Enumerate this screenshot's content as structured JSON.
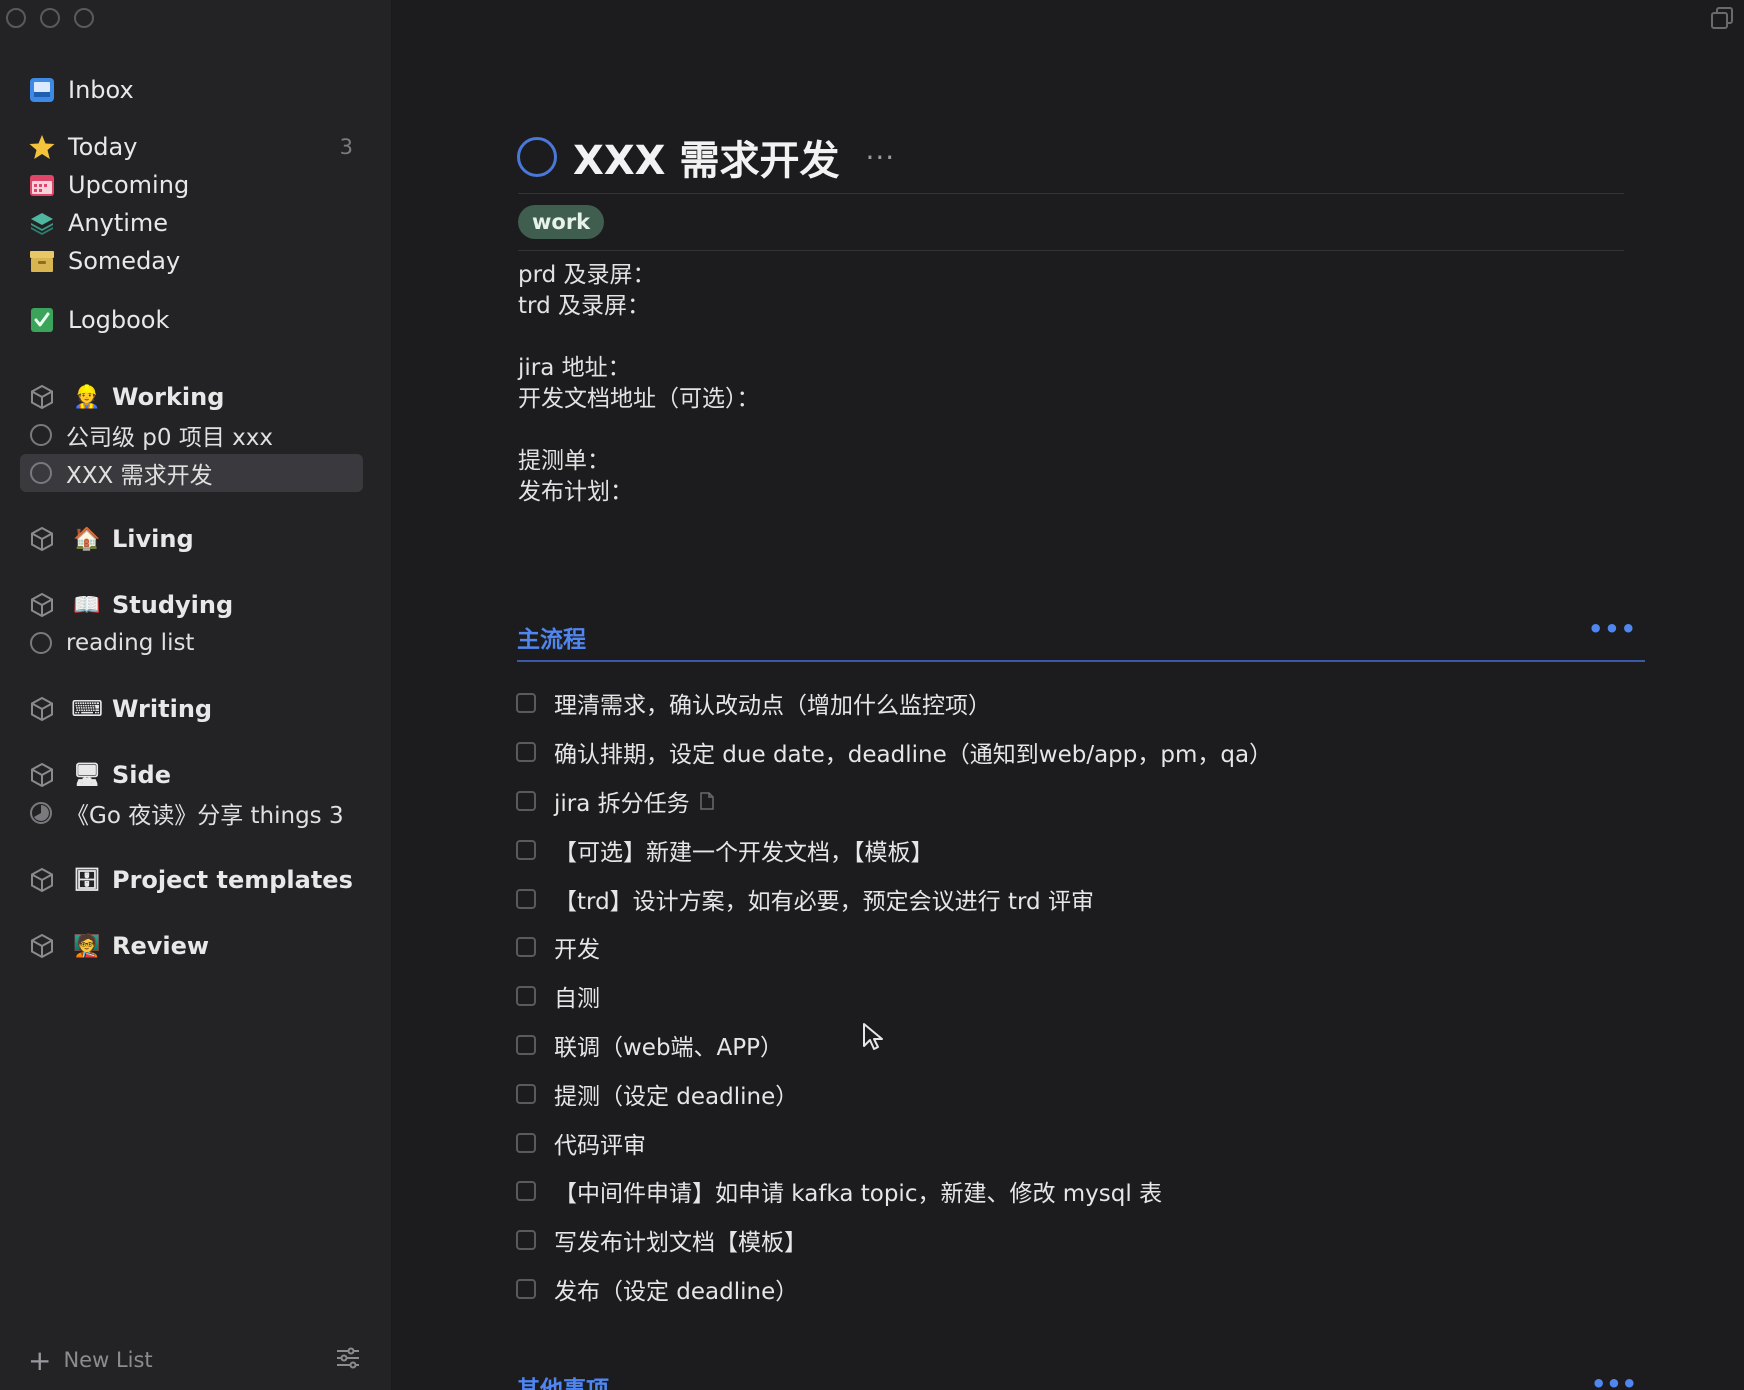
{
  "sidebar": {
    "nav": [
      {
        "label": "Inbox",
        "icon": "inbox-icon",
        "count": ""
      },
      {
        "label": "Today",
        "icon": "star-icon",
        "count": "3"
      },
      {
        "label": "Upcoming",
        "icon": "calendar-icon",
        "count": ""
      },
      {
        "label": "Anytime",
        "icon": "layers-icon",
        "count": ""
      },
      {
        "label": "Someday",
        "icon": "archive-box-icon",
        "count": ""
      },
      {
        "label": "Logbook",
        "icon": "logbook-check-icon",
        "count": ""
      }
    ],
    "areas": [
      {
        "label": "Working",
        "emoji": "👷",
        "projects": [
          "公司级 p0 项目 xxx",
          "XXX 需求开发"
        ]
      },
      {
        "label": "Living",
        "emoji": "🏠",
        "projects": []
      },
      {
        "label": "Studying",
        "emoji": "📖",
        "projects": [
          "reading list"
        ]
      },
      {
        "label": "Writing",
        "emoji": "⌨",
        "projects": []
      },
      {
        "label": "Side",
        "emoji": "🖥",
        "projects": [
          "《Go 夜读》分享 things 3"
        ]
      },
      {
        "label": "Project templates",
        "emoji": "🗄",
        "projects": []
      },
      {
        "label": "Review",
        "emoji": "🧑‍🏫",
        "projects": []
      }
    ],
    "footer": {
      "new_list": "New List"
    }
  },
  "project": {
    "title": "XXX 需求开发",
    "more": "···",
    "tag": "work",
    "notes": {
      "line1": "prd 及录屏：",
      "line2": "trd 及录屏：",
      "line3": "jira 地址：",
      "line4": "开发文档地址（可选）：",
      "line5": "提测单：",
      "line6": "发布计划："
    },
    "section1": {
      "heading": "主流程",
      "dots": "•••",
      "items": [
        "理清需求，确认改动点（增加什么监控项）",
        "确认排期，设定 due date，deadline（通知到web/app，pm，qa）",
        "jira 拆分任务",
        "【可选】新建一个开发文档，【模板】",
        "【trd】设计方案，如有必要，预定会议进行 trd 评审",
        "开发",
        "自测",
        "联调（web端、APP）",
        "提测（设定 deadline）",
        "代码评审",
        "【中间件申请】如申请  kafka topic，新建、修改  mysql 表",
        "写发布计划文档【模板】",
        "发布（设定 deadline）"
      ]
    },
    "section2": {
      "heading": "其他事项",
      "dots": "•••"
    }
  },
  "colors": {
    "accent": "#4f86f0",
    "tag_bg": "#3f5e4f",
    "sidebar_bg": "#232326",
    "main_bg": "#1c1c1e"
  }
}
